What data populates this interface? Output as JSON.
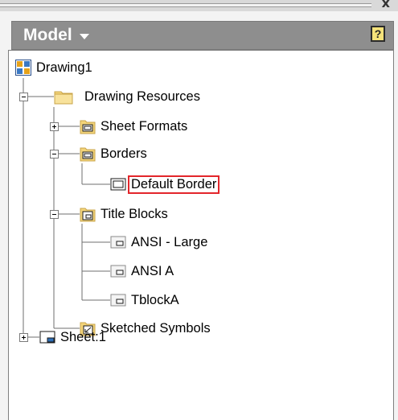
{
  "panel": {
    "title": "Model",
    "help_label": "?"
  },
  "tree": {
    "drawing": "Drawing1",
    "resources": "Drawing Resources",
    "sheet_formats": "Sheet Formats",
    "borders": "Borders",
    "default_border": "Default Border",
    "title_blocks": "Title Blocks",
    "ansi_large": "ANSI - Large",
    "ansi_a": "ANSI A",
    "tblock_a": "TblockA",
    "sketched_symbols": "Sketched Symbols",
    "sheet": "Sheet:1"
  },
  "colors": {
    "header_bg": "#8e8e8e",
    "selection_border": "#e3262b",
    "folder_fill": "#f4d57a"
  }
}
